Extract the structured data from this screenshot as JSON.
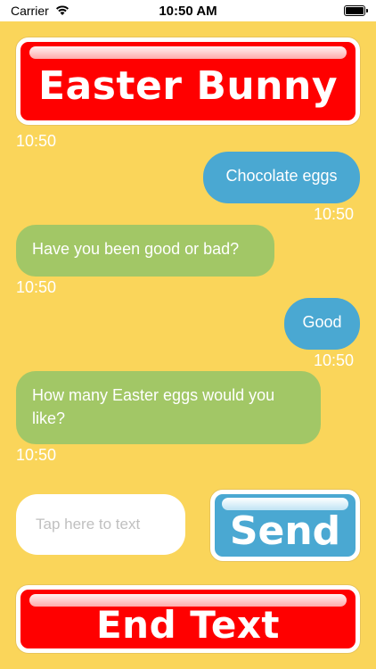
{
  "status_bar": {
    "carrier": "Carrier",
    "time": "10:50 AM",
    "wifi_icon": "wifi-icon",
    "battery_icon": "battery-icon"
  },
  "title_button": {
    "label": "Easter Bunny"
  },
  "messages": [
    {
      "time": "10:50"
    },
    {
      "text": "Chocolate eggs",
      "time": "10:50",
      "sender": "user"
    },
    {
      "text": "Have you been good or bad?",
      "time": "10:50",
      "sender": "bunny"
    },
    {
      "text": "Good",
      "time": "10:50",
      "sender": "user"
    },
    {
      "text": "How many Easter eggs would you like?",
      "time": "10:50",
      "sender": "bunny"
    }
  ],
  "composer": {
    "placeholder": "Tap here to text",
    "send_label": "Send"
  },
  "end_button": {
    "label": "End Text"
  },
  "colors": {
    "background": "#fad55a",
    "red_button": "#ff0000",
    "blue_bubble": "#4aa8d2",
    "green_bubble": "#a2c766"
  }
}
